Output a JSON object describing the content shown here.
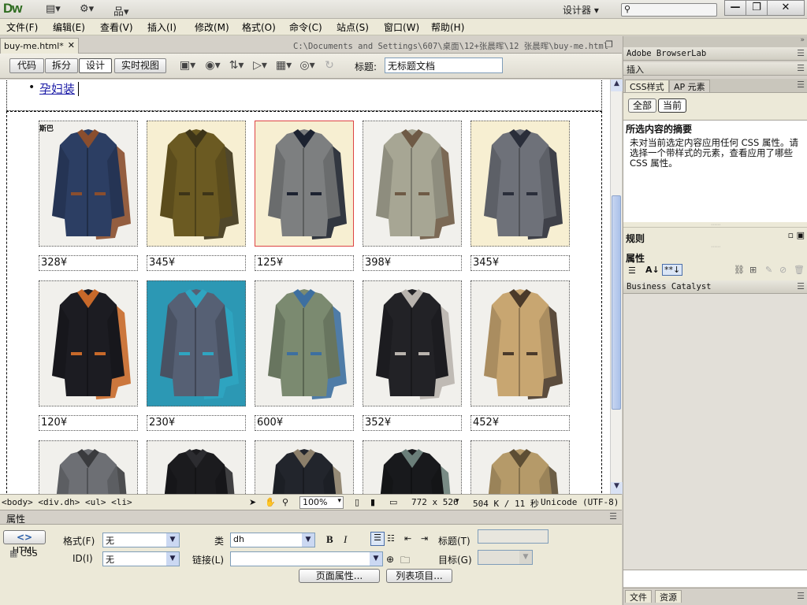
{
  "app": {
    "logo": "Dw",
    "workspace": "设计器 ▾",
    "search_placeholder": "",
    "win_buttons": [
      "—",
      "❐",
      "✕"
    ]
  },
  "menu": [
    "文件(F)",
    "编辑(E)",
    "查看(V)",
    "插入(I)",
    "修改(M)",
    "格式(O)",
    "命令(C)",
    "站点(S)",
    "窗口(W)",
    "帮助(H)"
  ],
  "document": {
    "tab": "buy-me.html*",
    "path": "C:\\Documents and Settings\\607\\桌面\\12+张晨晖\\12 张晨晖\\buy-me.html"
  },
  "toolbar": {
    "views": [
      "代码",
      "拆分",
      "设计",
      "实时视图"
    ],
    "title_label": "标题:",
    "title_value": "无标题文档"
  },
  "canvas": {
    "nav_item": "孕妇装",
    "image_overlay_text": "斯巴",
    "rows": [
      {
        "products": [
          {
            "price": "328¥",
            "colors": [
              "#2c3e63",
              "#8a4e2e"
            ]
          },
          {
            "price": "345¥",
            "colors": [
              "#6b5a22",
              "#3d3418"
            ]
          },
          {
            "price": "125¥",
            "colors": [
              "#7d7f80",
              "#1c2230"
            ]
          },
          {
            "price": "398¥",
            "colors": [
              "#a7a694",
              "#6e5a45"
            ]
          },
          {
            "price": "345¥",
            "colors": [
              "#6e7179",
              "#2a2e3a"
            ]
          }
        ]
      },
      {
        "products": [
          {
            "price": "120¥",
            "colors": [
              "#1c1c22",
              "#c8692a"
            ]
          },
          {
            "price": "230¥",
            "colors": [
              "#566074",
              "#2fa5c1"
            ]
          },
          {
            "price": "600¥",
            "colors": [
              "#7b8a70",
              "#3d6fa0"
            ]
          },
          {
            "price": "352¥",
            "colors": [
              "#222226",
              "#b9b4ae"
            ]
          },
          {
            "price": "452¥",
            "colors": [
              "#c8a671",
              "#4a3a2a"
            ]
          }
        ]
      },
      {
        "products": [
          {
            "price": "",
            "colors": [
              "#6d6f74",
              "#3a3b3e"
            ]
          },
          {
            "price": "",
            "colors": [
              "#1b1b1e",
              "#2c2c30"
            ]
          },
          {
            "price": "",
            "colors": [
              "#22252c",
              "#8c7f6a"
            ]
          },
          {
            "price": "",
            "colors": [
              "#18191c",
              "#6b7f7a"
            ]
          },
          {
            "price": "",
            "colors": [
              "#b59a69",
              "#5d4e34"
            ]
          }
        ]
      }
    ]
  },
  "status": {
    "tag_selector": "<body> <div.dh> <ul> <li>",
    "zoom": "100%",
    "size": "772 x 526",
    "weight": "504 K / 11 秒",
    "encoding": "Unicode (UTF-8)"
  },
  "properties": {
    "header": "属性",
    "html_btn": "HTML",
    "css_btn": "CSS",
    "format_label": "格式(F)",
    "format_value": "无",
    "id_label": "ID(I)",
    "id_value": "无",
    "class_label": "类",
    "class_value": "dh",
    "link_label": "链接(L)",
    "link_value": "",
    "title_label": "标题(T)",
    "target_label": "目标(G)",
    "bold": "B",
    "italic": "I",
    "page_props_btn": "页面属性...",
    "list_item_btn": "列表项目..."
  },
  "right_panel": {
    "browserlab": "Adobe BrowserLab",
    "insert": "插入",
    "tabs": [
      "CSS样式",
      "AP 元素"
    ],
    "mode_buttons": [
      "全部",
      "当前"
    ],
    "summary_title": "所选内容的摘要",
    "summary_text": "未对当前选定内容应用任何 CSS 属性。请选择一个带样式的元素，查看应用了哪些 CSS 属性。",
    "rules_label": "规则",
    "props_label": "属性",
    "business_catalyst": "Business Catalyst",
    "bottom_tabs": [
      "文件",
      "资源"
    ]
  }
}
